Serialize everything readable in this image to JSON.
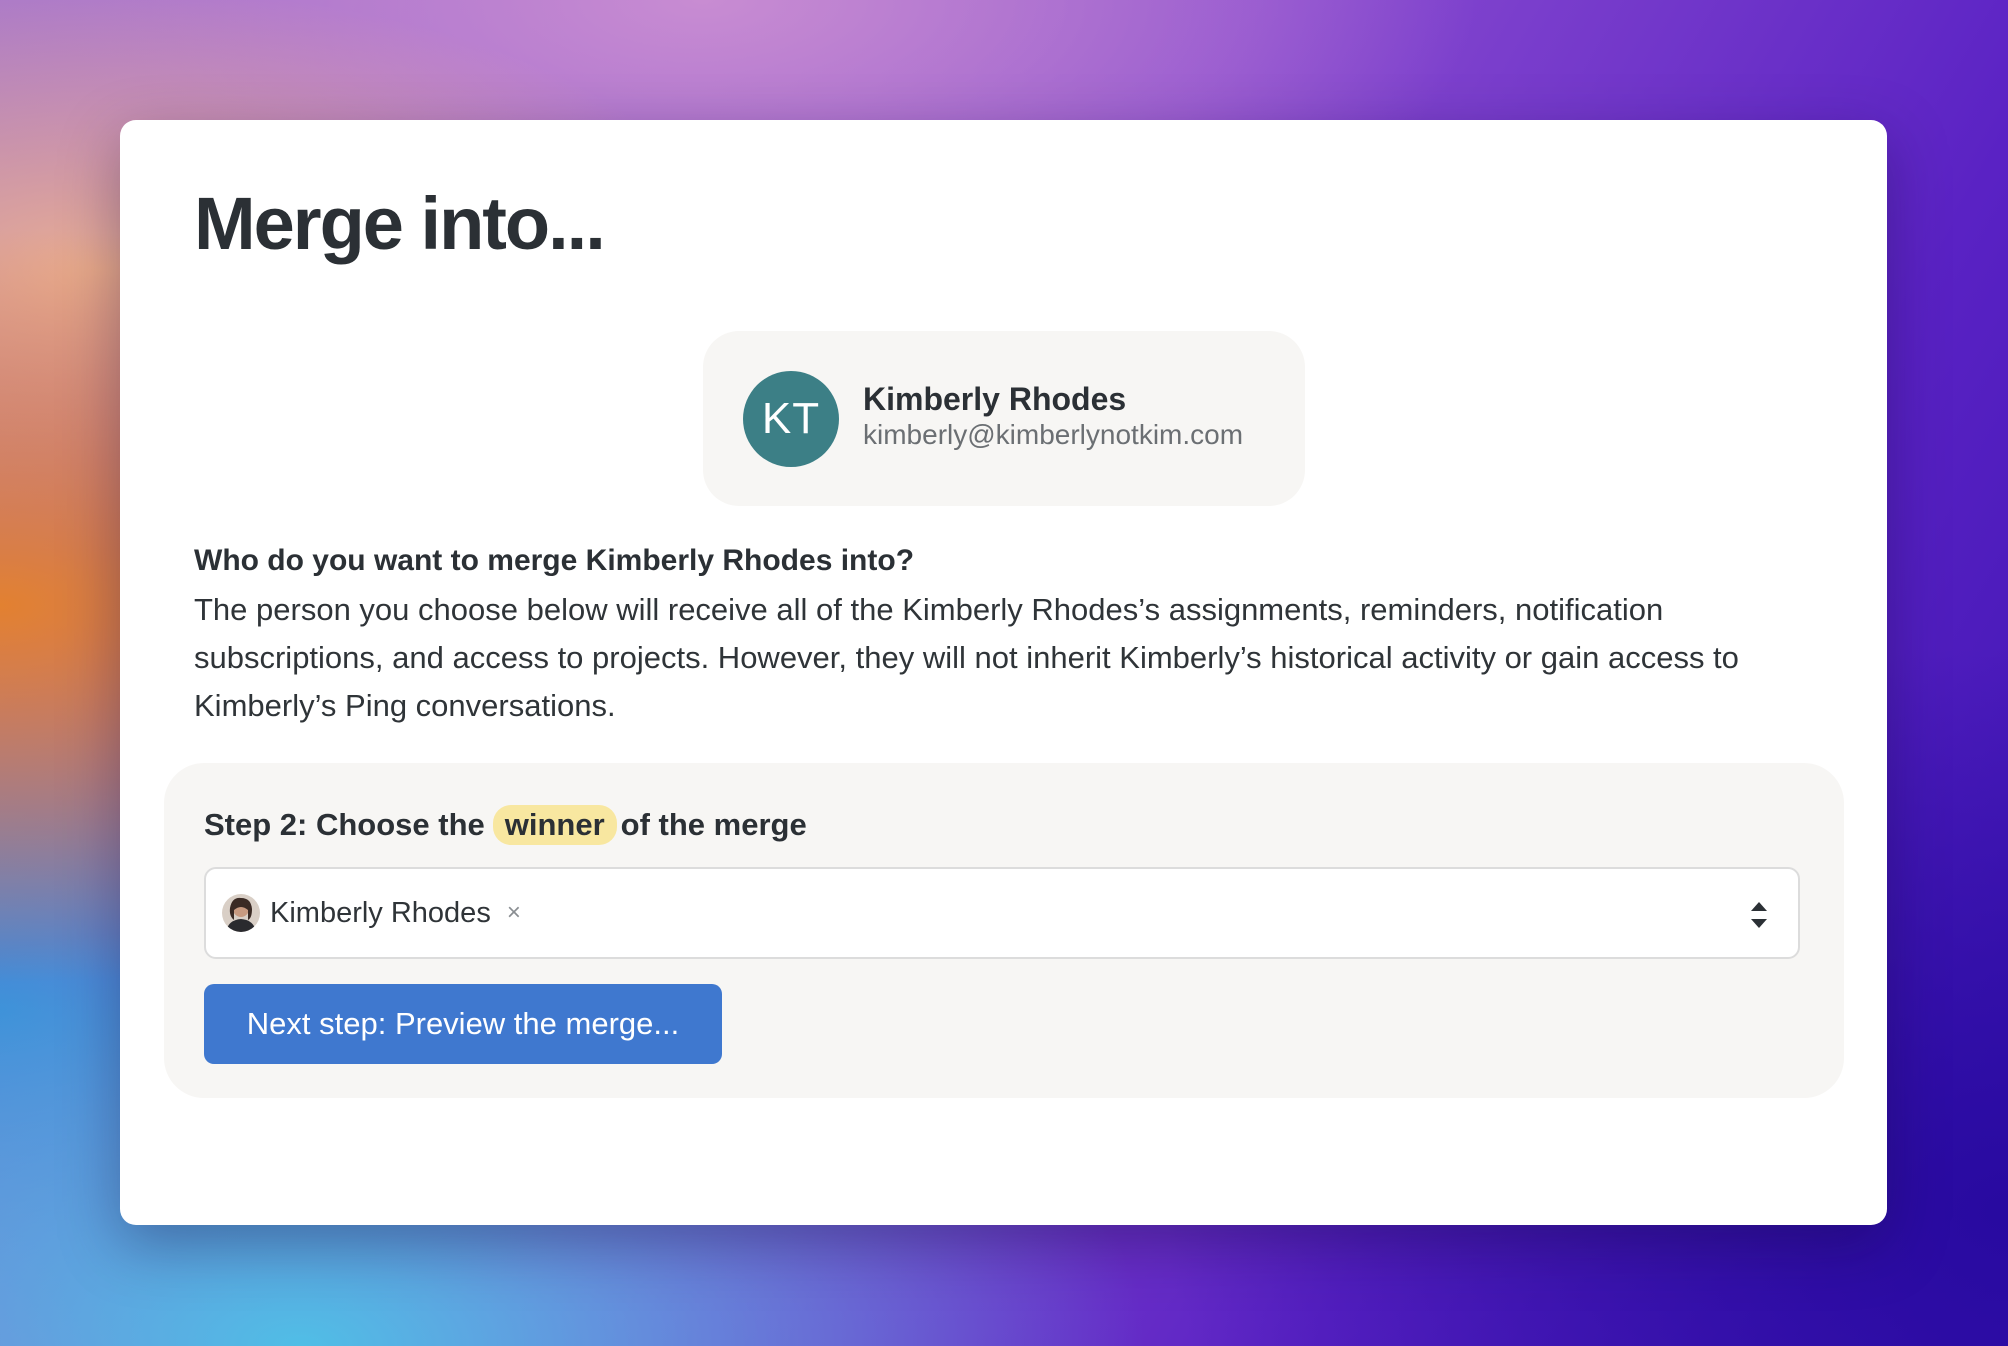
{
  "dialog": {
    "title": "Merge into..."
  },
  "source_person": {
    "initials": "KT",
    "name": "Kimberly Rhodes",
    "email": "kimberly@kimberlynotkim.com",
    "avatar_color": "#3c7f86"
  },
  "question": "Who do you want to merge Kimberly Rhodes into?",
  "description": "The person you choose below will receive all of the Kimberly Rhodes’s assignments, reminders, notification subscriptions, and access to projects. However, they will not inherit Kimberly’s historical activity or gain access to Kimberly’s Ping conversations.",
  "step": {
    "prefix": "Step 2: Choose the",
    "highlight": "winner",
    "suffix": "of the merge",
    "highlight_color": "#f8e7a0"
  },
  "select": {
    "selected_label": "Kimberly Rhodes",
    "remove_glyph": "×"
  },
  "next_button": {
    "label": "Next step: Preview the merge...",
    "color": "#3f78cf"
  }
}
